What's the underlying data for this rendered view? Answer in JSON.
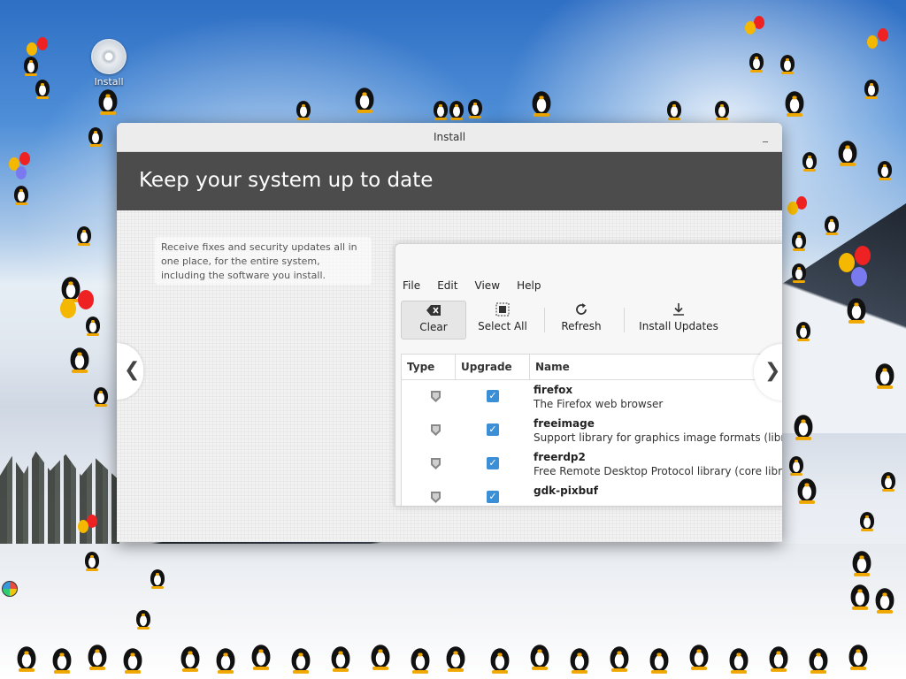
{
  "desktop": {
    "icon_label": "Install"
  },
  "window": {
    "title": "Install",
    "minimize_glyph": "_",
    "banner_title": "Keep your system up to date",
    "description": "Receive fixes and security updates all in one place, for the entire system, including the software you install.",
    "nav_prev_glyph": "❮",
    "nav_next_glyph": "❯"
  },
  "update_manager": {
    "menu": [
      "File",
      "Edit",
      "View",
      "Help"
    ],
    "toolbar": {
      "clear": "Clear",
      "select_all": "Select All",
      "refresh": "Refresh",
      "install_updates": "Install Updates"
    },
    "columns": {
      "type": "Type",
      "upgrade": "Upgrade",
      "name": "Name"
    },
    "rows": [
      {
        "name": "firefox",
        "description": "The Firefox web browser",
        "checked": true
      },
      {
        "name": "freeimage",
        "description": "Support library for graphics image formats (libr",
        "checked": true
      },
      {
        "name": "freerdp2",
        "description": "Free Remote Desktop Protocol library (core libr",
        "checked": true
      },
      {
        "name": "gdk-pixbuf",
        "description": "",
        "checked": true
      }
    ],
    "check_glyph": "✓"
  }
}
